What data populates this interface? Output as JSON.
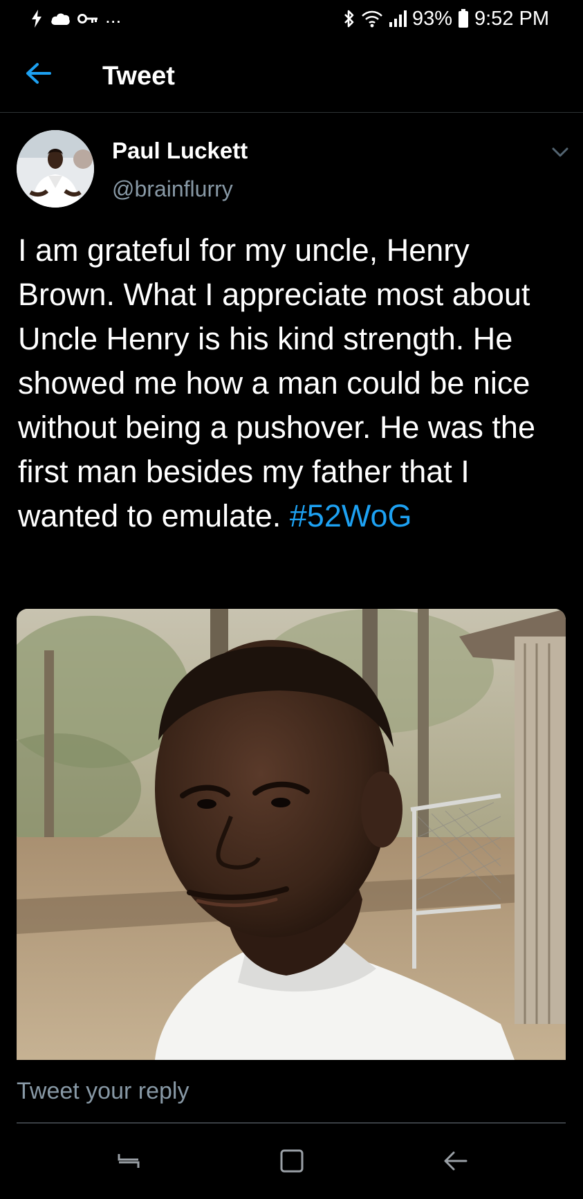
{
  "status_bar": {
    "left_icons": [
      "bolt-icon",
      "cloud-icon",
      "key-icon"
    ],
    "ellipsis": "...",
    "battery_percent": "93%",
    "time": "9:52 PM"
  },
  "nav": {
    "title": "Tweet"
  },
  "tweet": {
    "author_name": "Paul Luckett",
    "author_handle": "@brainflurry",
    "text": "I am grateful for my uncle, Henry Brown. What I appreciate most about Uncle Henry is his kind strength. He showed me how a man could be nice without being a pushover. He was the first man besides my father that I wanted to emulate.",
    "hashtag": "#52WoG"
  },
  "reply": {
    "placeholder": "Tweet your reply"
  },
  "system_nav": {
    "buttons": [
      "recents-icon",
      "home-icon",
      "back-icon"
    ]
  },
  "colors": {
    "background": "#000000",
    "accent": "#1da1f2",
    "secondary_text": "#8899a6",
    "divider": "#2f3336"
  }
}
